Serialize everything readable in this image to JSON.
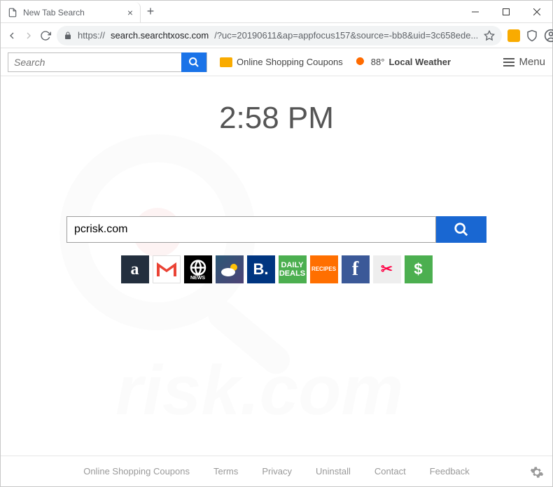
{
  "window": {
    "tab_title": "New Tab Search"
  },
  "address_bar": {
    "url_prefix": "https://",
    "url_host": "search.searchtxosc.com",
    "url_rest": "/?uc=20190611&ap=appfocus157&source=-bb8&uid=3c658ede..."
  },
  "topbar": {
    "search_placeholder": "Search",
    "coupons_label": "Online Shopping Coupons",
    "weather_temp": "88°",
    "weather_label": "Local Weather",
    "menu_label": "Menu"
  },
  "clock": {
    "time": "2:58 PM"
  },
  "main_search": {
    "value": "pcrisk.com"
  },
  "tiles": {
    "amazon": "a",
    "news": "NEWS",
    "booking": "B.",
    "deals": "DAILY DEALS",
    "recipes": "RECIPES",
    "fb": "f",
    "money": "$"
  },
  "footer": {
    "links": [
      "Online Shopping Coupons",
      "Terms",
      "Privacy",
      "Uninstall",
      "Contact",
      "Feedback"
    ]
  },
  "watermark": "pcrisk.com"
}
